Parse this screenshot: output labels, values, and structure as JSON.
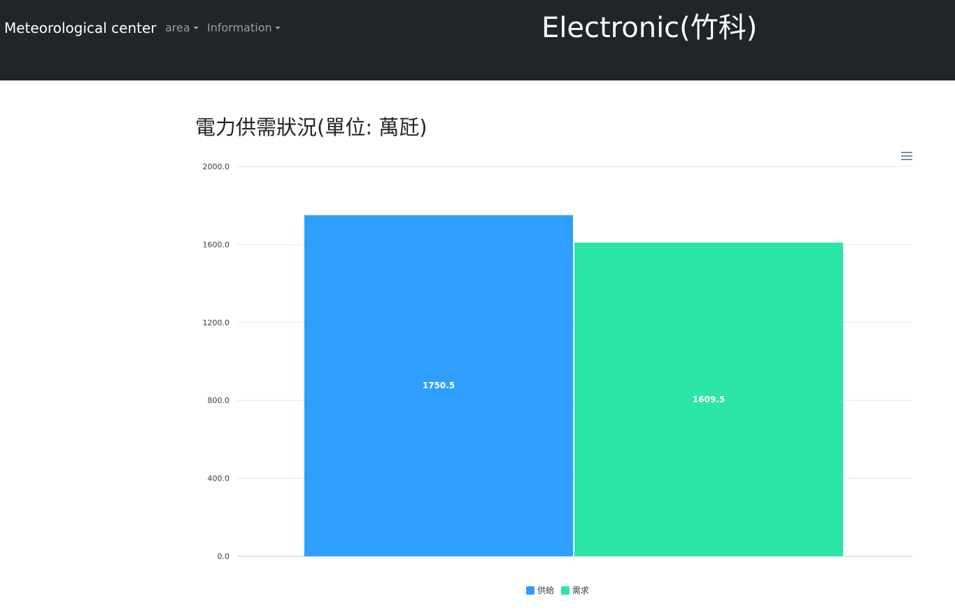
{
  "navbar": {
    "brand": "Meteorological center",
    "links": [
      {
        "label": "area"
      },
      {
        "label": "Information"
      }
    ],
    "site_title": "Electronic(竹科)"
  },
  "page": {
    "heading": "電力供需狀況(單位: 萬瓩)",
    "menu_icon": "hamburger-menu-icon"
  },
  "colors": {
    "navbar_bg": "#212529",
    "supply": "#2a9dfd",
    "demand": "#27e5a3"
  },
  "chart_data": {
    "type": "bar",
    "categories": [
      "供給",
      "需求"
    ],
    "series": [
      {
        "name": "供給",
        "values": [
          1750.5
        ],
        "color": "#2a9dfd"
      },
      {
        "name": "需求",
        "values": [
          1609.5
        ],
        "color": "#27e5a3"
      }
    ],
    "values": [
      1750.5,
      1609.5
    ],
    "data_labels": [
      "1750.5",
      "1609.5"
    ],
    "y_ticks": [
      "0.0",
      "400.0",
      "800.0",
      "1200.0",
      "1600.0",
      "2000.0"
    ],
    "ylim": [
      0,
      2000
    ],
    "grid": true,
    "legend_placement": "bottom-center",
    "title": "",
    "xlabel": "",
    "ylabel": ""
  }
}
